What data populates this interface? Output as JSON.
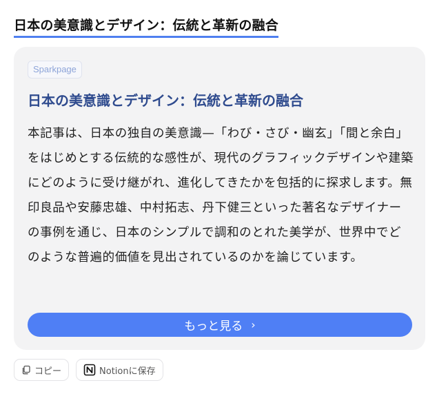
{
  "header": {
    "title": "日本の美意識とデザイン：伝統と革新の融合"
  },
  "card": {
    "brand": "Sparkpage",
    "title": "日本の美意識とデザイン：伝統と革新の融合",
    "body": "本記事は、日本の独自の美意識—「わび・さび・幽玄」「間と余白」をはじめとする伝統的な感性が、現代のグラフィックデザインや建築にどのように受け継がれ、進化してきたかを包括的に探求します。無印良品や安藤忠雄、中村拓志、丹下健三といった著名なデザイナーの事例を通じ、日本のシンプルで調和のとれた美学が、世界中でどのような普遍的価値を見出されているのかを論じています。",
    "more_label": "もっと見る",
    "more_icon": "chevron-right-icon"
  },
  "actions": {
    "copy_label": "コピー",
    "copy_icon": "copy-icon",
    "notion_label": "Notionに保存",
    "notion_icon": "notion-icon"
  },
  "colors": {
    "accent": "#4f7ff5",
    "title_blue": "#2f4b8e",
    "card_bg": "#f3f3f4"
  }
}
